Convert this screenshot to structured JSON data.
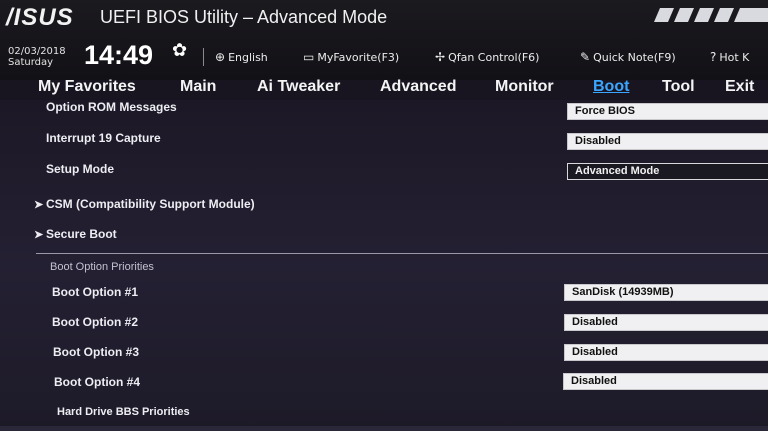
{
  "header": {
    "logo": "/ISUS",
    "title": "UEFI BIOS Utility – Advanced Mode",
    "date": "02/03/2018",
    "day": "Saturday",
    "time": "14:49"
  },
  "utilities": [
    {
      "label": "English",
      "icon": "globe-icon"
    },
    {
      "label": "MyFavorite(F3)",
      "icon": "favorite-icon"
    },
    {
      "label": "Qfan Control(F6)",
      "icon": "fan-icon"
    },
    {
      "label": "Quick Note(F9)",
      "icon": "note-icon"
    },
    {
      "label": "Hot K",
      "icon": "help-icon"
    }
  ],
  "tabs": [
    "My Favorites",
    "Main",
    "Ai Tweaker",
    "Advanced",
    "Monitor",
    "Boot",
    "Tool",
    "Exit"
  ],
  "active_tab": "Boot",
  "settings": [
    {
      "label": "Option ROM Messages",
      "value": "Force BIOS"
    },
    {
      "label": "Interrupt 19 Capture",
      "value": "Disabled"
    },
    {
      "label": "Setup Mode",
      "value": "Advanced Mode"
    }
  ],
  "submenus": [
    {
      "label": "CSM (Compatibility Support Module)"
    },
    {
      "label": "Secure Boot"
    }
  ],
  "boot_priorities": {
    "section_title": "Boot Option Priorities",
    "options": [
      {
        "label": "Boot Option #1",
        "value": "SanDisk  (14939MB)"
      },
      {
        "label": "Boot Option #2",
        "value": "Disabled"
      },
      {
        "label": "Boot Option #3",
        "value": "Disabled"
      },
      {
        "label": "Boot Option #4",
        "value": "Disabled"
      }
    ],
    "bbs_label": "Hard Drive BBS Priorities"
  },
  "colors": {
    "active_tab": "#3aa6ff",
    "background": "#181520"
  }
}
